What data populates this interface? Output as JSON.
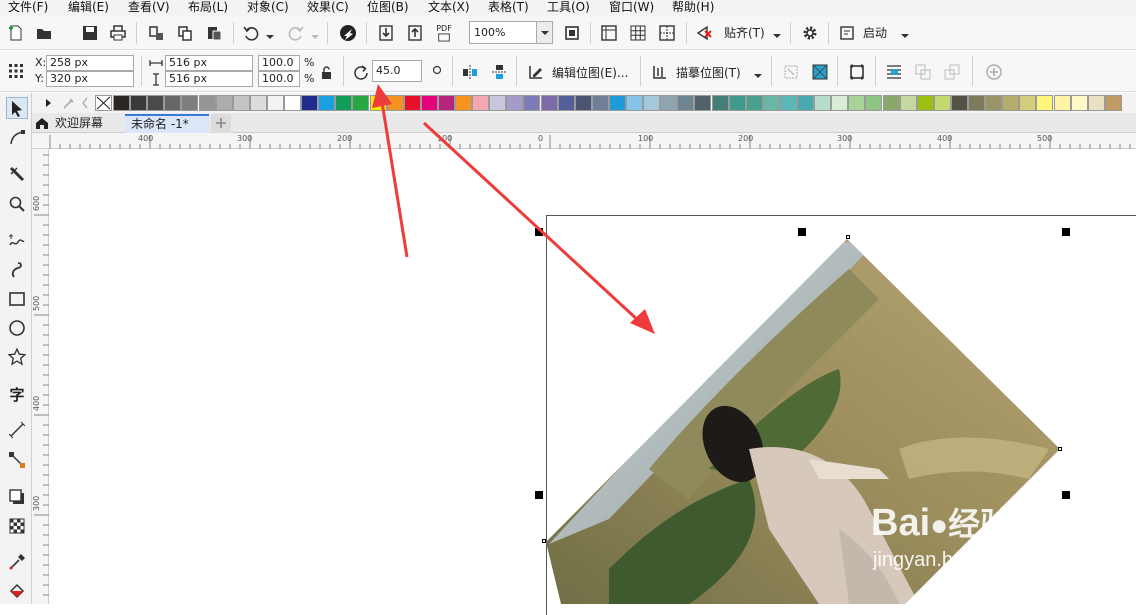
{
  "menu": {
    "items": [
      "文件(F)",
      "编辑(E)",
      "查看(V)",
      "布局(L)",
      "对象(C)",
      "效果(C)",
      "位图(B)",
      "文本(X)",
      "表格(T)",
      "工具(O)",
      "窗口(W)",
      "帮助(H)"
    ]
  },
  "toolbar": {
    "zoom_value": "100%",
    "snap_label": "贴齐(T)",
    "launch_label": "启动",
    "pdf_label": "PDF"
  },
  "propbar": {
    "x_label": "X:",
    "y_label": "Y:",
    "x_value": "258 px",
    "y_value": "320 px",
    "width_value": "516 px",
    "height_value": "516 px",
    "scale_w": "100.0",
    "scale_h": "100.0",
    "pct": "%",
    "rotation_value": "45.0",
    "edit_bitmap_label": "编辑位图(E)...",
    "trace_bitmap_label": "描摹位图(T)"
  },
  "tabs": {
    "welcome": "欢迎屏幕",
    "document": "未命名 -1*"
  },
  "ruler": {
    "h_labels": [
      "400",
      "300",
      "200",
      "100",
      "0",
      "100",
      "200",
      "300",
      "400",
      "500"
    ],
    "v_labels": [
      "600",
      "500",
      "400",
      "300"
    ]
  },
  "palette": {
    "colors": [
      "#2b2523",
      "#3a3a3a",
      "#4a4a4a",
      "#666666",
      "#7d7d7d",
      "#959595",
      "#acacac",
      "#c4c4c4",
      "#dcdcdc",
      "#f2f2f2",
      "#ffffff",
      "#1f2c8c",
      "#1a9fe0",
      "#0f9d58",
      "#27a844",
      "#ffe600",
      "#f6921e",
      "#e8112d",
      "#e5007e",
      "#b5267b",
      "#f7931e",
      "#f4a6b2",
      "#c9c7de",
      "#a59bc9",
      "#7f7ab8",
      "#7d6aa8",
      "#535f9a",
      "#4b5470",
      "#6f7f98",
      "#1d9bd6",
      "#86c5e8",
      "#a3c8dc",
      "#90a4b0",
      "#6e8591",
      "#4f6169",
      "#447f77",
      "#3e9a8c",
      "#4a9f8f",
      "#6ab6a5",
      "#5bb7b7",
      "#48aab0",
      "#b7dcc9",
      "#d9ecd5",
      "#a7d39b",
      "#8fc584",
      "#8aa86a",
      "#c7d7a1",
      "#9cc012",
      "#c5d870",
      "#545245",
      "#7c7a5b",
      "#999566",
      "#b5ad6c",
      "#d4cd7b",
      "#fff67a",
      "#fff3a6",
      "#fff8c7",
      "#e8e0c0",
      "#c29a64"
    ]
  },
  "watermark": {
    "brand": "Bai",
    "brand_cn": "经验",
    "url": "jingyan.baidu.com"
  }
}
